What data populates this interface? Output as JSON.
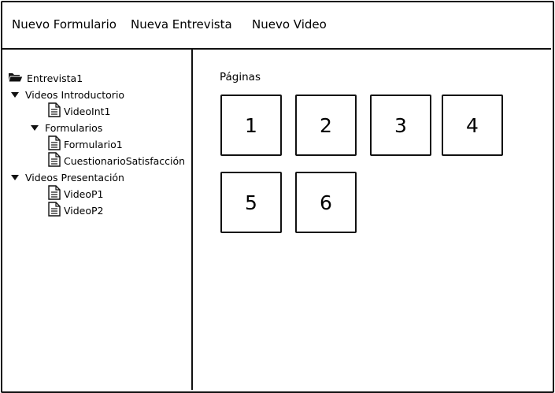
{
  "menu": {
    "items": [
      {
        "label": "Nuevo Formulario"
      },
      {
        "label": "Nueva Entrevista"
      },
      {
        "label": "Nuevo Video"
      }
    ]
  },
  "tree": {
    "root": {
      "label": "Entrevista1",
      "icon": "folder-open-icon"
    },
    "nodes": [
      {
        "label": "Videos Introductorio",
        "icon": "caret-down-icon"
      },
      {
        "label": "VideoInt1",
        "icon": "document-icon"
      },
      {
        "label": "Formularios",
        "icon": "caret-down-icon"
      },
      {
        "label": "Formulario1",
        "icon": "document-icon"
      },
      {
        "label": "CuestionarioSatisfacción",
        "icon": "document-icon"
      },
      {
        "label": "Videos Presentación",
        "icon": "caret-down-icon"
      },
      {
        "label": "VideoP1",
        "icon": "document-icon"
      },
      {
        "label": "VideoP2",
        "icon": "document-icon"
      }
    ]
  },
  "pages": {
    "title": "Páginas",
    "items": [
      "1",
      "2",
      "3",
      "4",
      "5",
      "6"
    ]
  }
}
